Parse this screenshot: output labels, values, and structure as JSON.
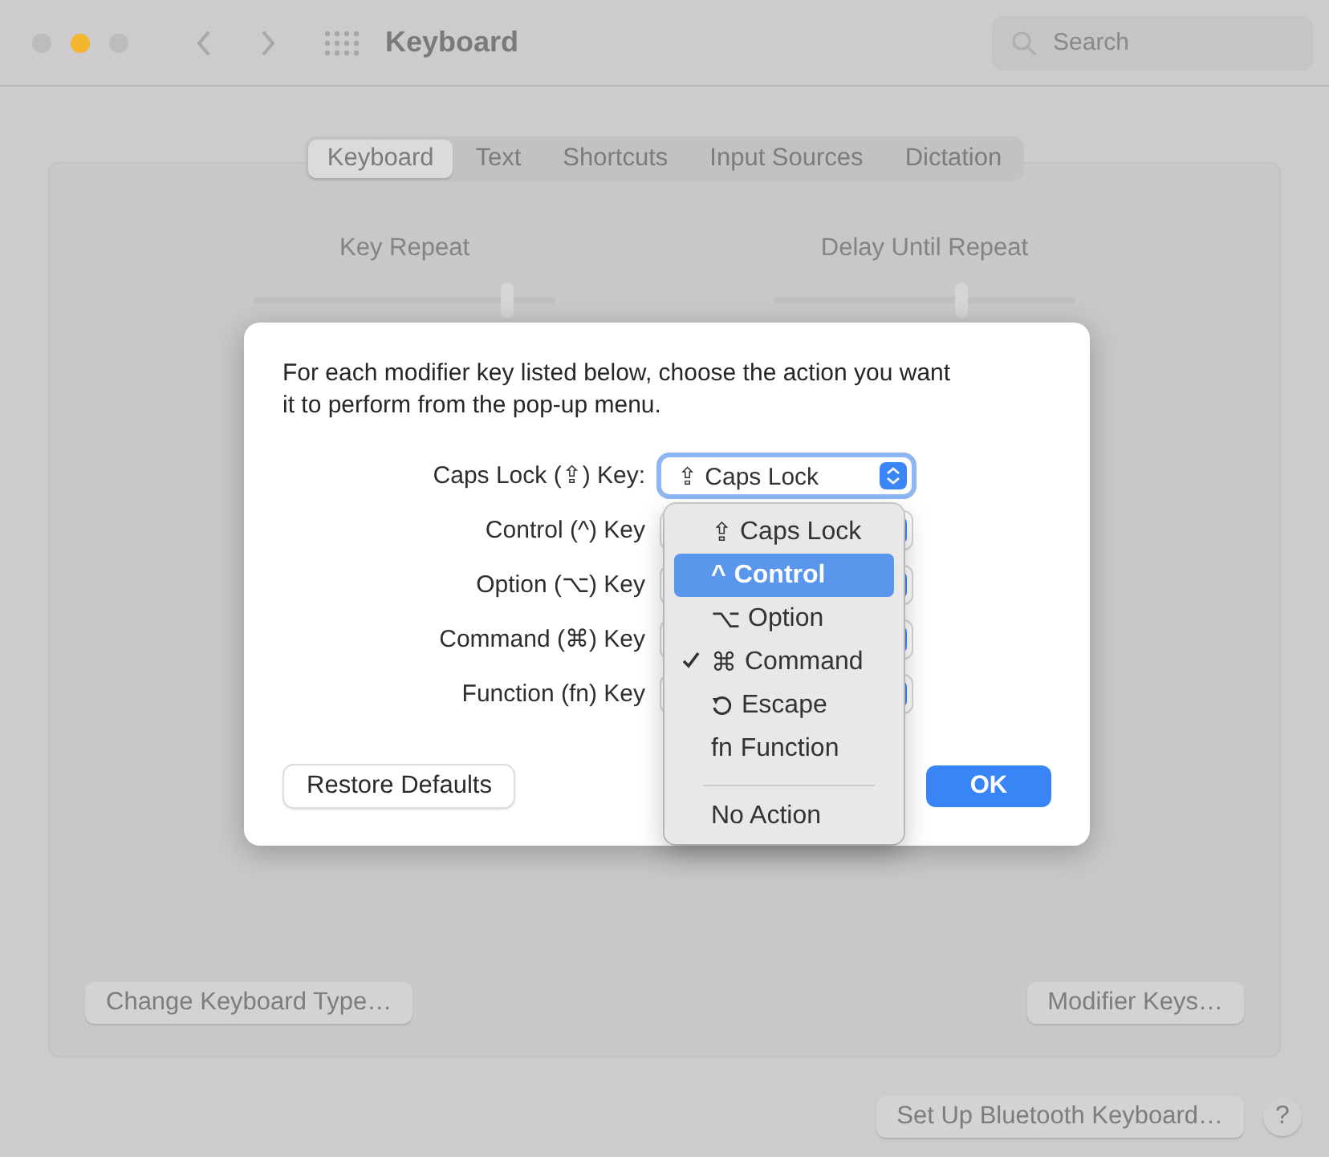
{
  "window": {
    "title": "Keyboard",
    "controls": [
      {
        "color": "#bdbbbd"
      },
      {
        "color": "#f4b52f"
      },
      {
        "color": "#bdbbbd"
      }
    ],
    "search": {
      "placeholder": "Search"
    }
  },
  "tabs": [
    {
      "label": "Keyboard",
      "selected": true
    },
    {
      "label": "Text",
      "selected": false
    },
    {
      "label": "Shortcuts",
      "selected": false
    },
    {
      "label": "Input Sources",
      "selected": false
    },
    {
      "label": "Dictation",
      "selected": false
    }
  ],
  "sliders": [
    {
      "label": "Key Repeat",
      "level": 0.84
    },
    {
      "label": "Delay Until Repeat",
      "level": 0.62
    }
  ],
  "panel_buttons": [
    "Change Keyboard Type…",
    "Modifier Keys…"
  ],
  "footer": {
    "button": "Set Up Bluetooth Keyboard…",
    "help": "?"
  },
  "dialog": {
    "message": "For each modifier key listed below, choose the action you want it to perform from the pop-up menu.",
    "rows": [
      {
        "label": "Caps Lock (⇪) Key:",
        "value": "⇪ Caps Lock"
      },
      {
        "label": "Control (^) Key"
      },
      {
        "label": "Option (⌥) Key"
      },
      {
        "label": "Command (⌘) Key"
      },
      {
        "label": "Function (fn) Key"
      }
    ],
    "menu": [
      {
        "kind": "option",
        "symbol": "⇪",
        "label": "Caps Lock",
        "selected": false,
        "checked": false
      },
      {
        "kind": "option",
        "symbol": "^",
        "label": "Control",
        "selected": true,
        "checked": false
      },
      {
        "kind": "option",
        "symbol": "⌥",
        "label": "Option",
        "selected": false,
        "checked": false
      },
      {
        "kind": "option",
        "symbol": "⌘",
        "label": "Command",
        "selected": false,
        "checked": true
      },
      {
        "kind": "icon_option",
        "label": "Escape",
        "selected": false,
        "checked": false
      },
      {
        "kind": "option",
        "symbol": "fn",
        "label": "Function",
        "selected": false,
        "checked": false
      },
      {
        "kind": "separator"
      },
      {
        "kind": "option",
        "label": "No Action",
        "selected": false,
        "checked": false
      }
    ],
    "buttons": [
      {
        "kind": "secondary",
        "label": "Restore Defaults"
      },
      {
        "kind": "default",
        "label": "OK"
      }
    ]
  }
}
